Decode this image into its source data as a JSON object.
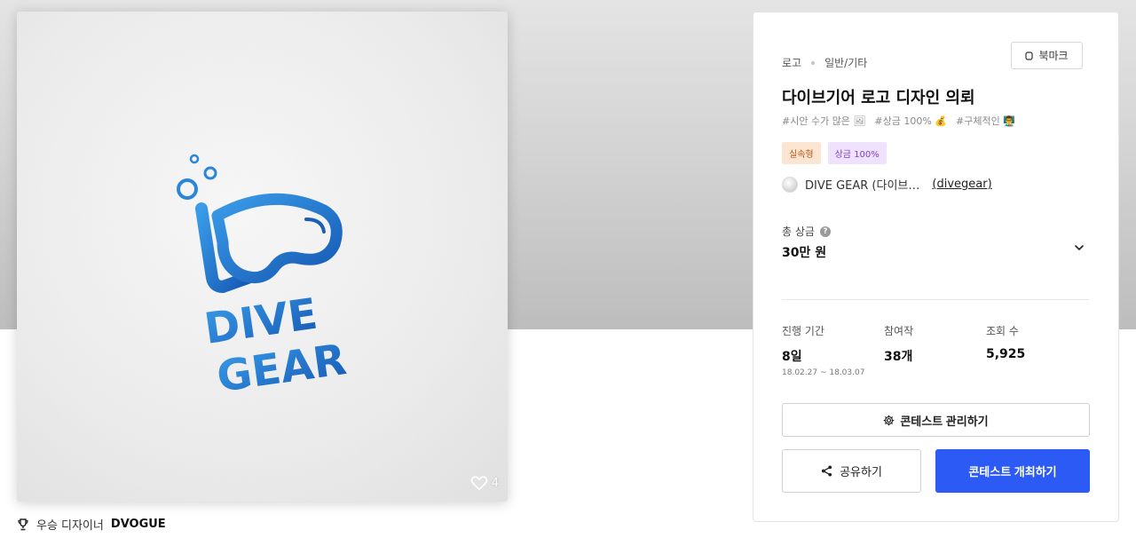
{
  "image_card": {
    "logo_text_line1": "DIVE",
    "logo_text_line2": "GEAR",
    "like_count": "4"
  },
  "winner": {
    "label": "우승 디자이너",
    "name": "DVOGUE"
  },
  "panel": {
    "breadcrumb": [
      "로고",
      "일반/기타"
    ],
    "bookmark_label": "북마크",
    "title": "다이브기어 로고 디자인 의뢰",
    "hashtags": [
      "#시안 수가 많은 🖼",
      "#상금 100% 💰",
      "#구체적인 👨‍🏫"
    ],
    "tags": {
      "type": "실속형",
      "prize": "상금 100%"
    },
    "host": {
      "name": "DIVE GEAR (다이브…",
      "id": "(divegear)"
    },
    "prize": {
      "label": "총 상금",
      "value": "30만 원"
    },
    "stats": {
      "period_label": "진행 기간",
      "period_value": "8일",
      "period_range": "18.02.27 ~ 18.03.07",
      "entries_label": "참여작",
      "entries_value": "38개",
      "views_label": "조회 수",
      "views_value": "5,925"
    },
    "buttons": {
      "manage": "콘테스트 관리하기",
      "share": "공유하기",
      "open": "콘테스트 개최하기"
    }
  },
  "colors": {
    "accent": "#2b5af5",
    "logo_blue": "#1d73c9",
    "tag_type_bg": "#fce6d2",
    "tag_prize_bg": "#efe2ff"
  }
}
